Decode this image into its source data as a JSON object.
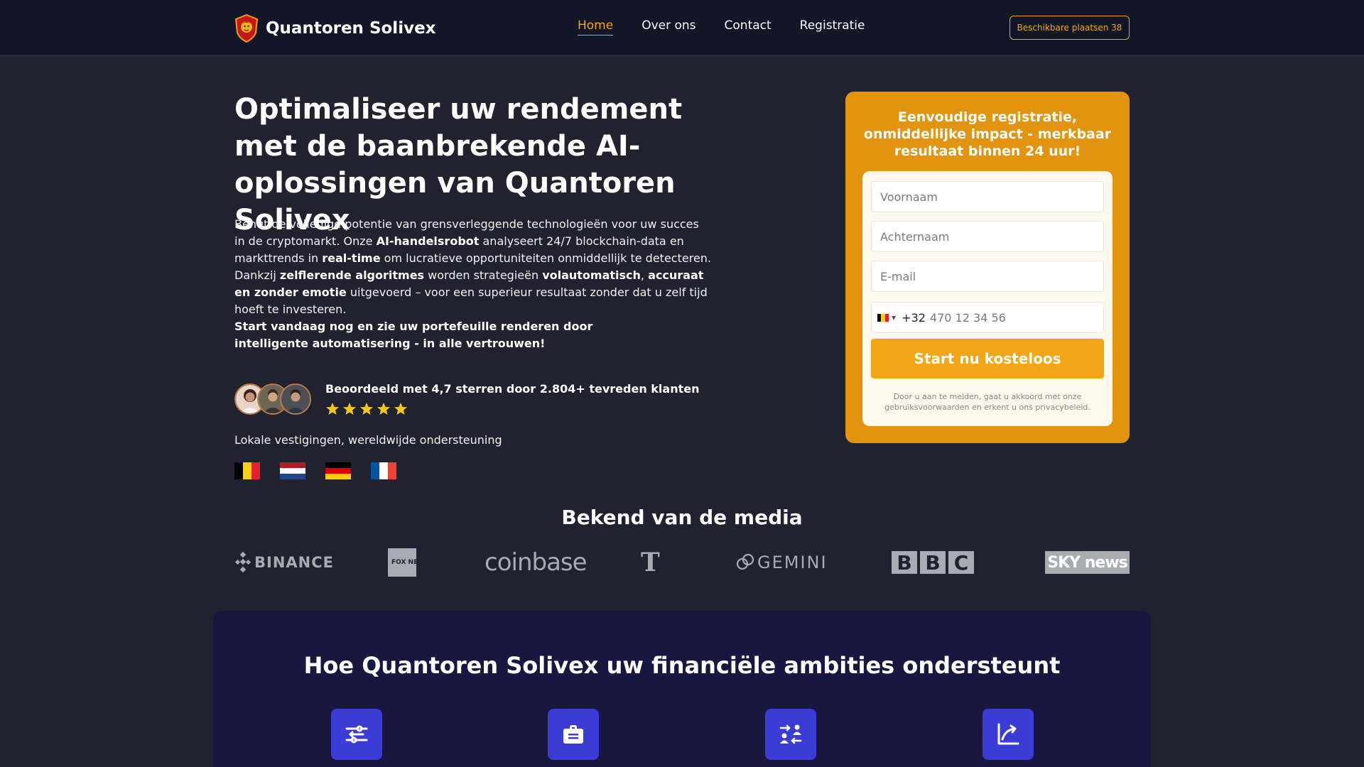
{
  "header": {
    "brand": "Quantoren Solivex",
    "nav": [
      {
        "label": "Home",
        "active": true
      },
      {
        "label": "Over ons",
        "active": false
      },
      {
        "label": "Contact",
        "active": false
      },
      {
        "label": "Registratie",
        "active": false
      }
    ],
    "seats_button": "Beschikbare plaatsen 38"
  },
  "hero": {
    "title": "Optimaliseer uw rendement met de baanbrekende AI-oplossingen van Quantoren Solivex",
    "paragraph": {
      "p1": "Benut de volledige potentie van grensverleggende technologieën voor uw succes in de cryptomarkt. Onze ",
      "b1": "AI-handelsrobot",
      "p2": " analyseert 24/7 blockchain-data en markttrends in ",
      "b2": "real-time",
      "p3": " om lucratieve opportuniteiten onmiddellijk te detecteren. Dankzij ",
      "b3": "zelflerende algoritmes",
      "p4": " worden strategieën ",
      "b4": "volautomatisch",
      "p5": ", ",
      "b5": "accuraat en zonder emotie",
      "p6": " uitgevoerd – voor een superieur resultaat zonder dat u zelf tijd hoeft te investeren."
    },
    "cta": "Start vandaag nog en zie uw portefeuille renderen door intelligente automatisering - in alle vertrouwen!",
    "rating_text": "Beoordeeld met 4,7 sterren door 2.804+ tevreden klanten",
    "stars": 5,
    "locations": "Lokale vestigingen, wereldwijde ondersteuning",
    "flags": [
      "belgium-flag",
      "netherlands-flag",
      "germany-flag",
      "france-flag"
    ]
  },
  "registration": {
    "title": "Eenvoudige registratie, onmiddellijke impact - merkbaar resultaat binnen 24 uur!",
    "first_name_placeholder": "Voornaam",
    "last_name_placeholder": "Achternaam",
    "email_placeholder": "E-mail",
    "phone_code": "+32",
    "phone_placeholder": "470 12 34 56",
    "submit": "Start nu kosteloos",
    "disclaimer": "Door u aan te melden, gaat u akkoord met onze gebruiksvoorwaarden en erkent u ons privacybeleid."
  },
  "media": {
    "title": "Bekend van de media",
    "logos": {
      "binance": "BINANCE",
      "fox": "FOX NEWS",
      "coinbase": "coinbase",
      "nyt": "T",
      "gemini": "GEMINI",
      "bbc": [
        "B",
        "B",
        "C"
      ],
      "sky": "SKY news"
    }
  },
  "features": {
    "title": "Hoe Quantoren Solivex uw financiële ambities ondersteunt",
    "icons": [
      "sliders-icon",
      "briefcase-icon",
      "user-exchange-icon",
      "growth-chart-icon"
    ]
  },
  "colors": {
    "accent": "#f0a514",
    "header_bg": "#121627",
    "page_bg": "#21212f",
    "card_bg": "#e2940e",
    "feature_bg": "#171740",
    "feature_icon_bg": "#3b3bd6"
  }
}
